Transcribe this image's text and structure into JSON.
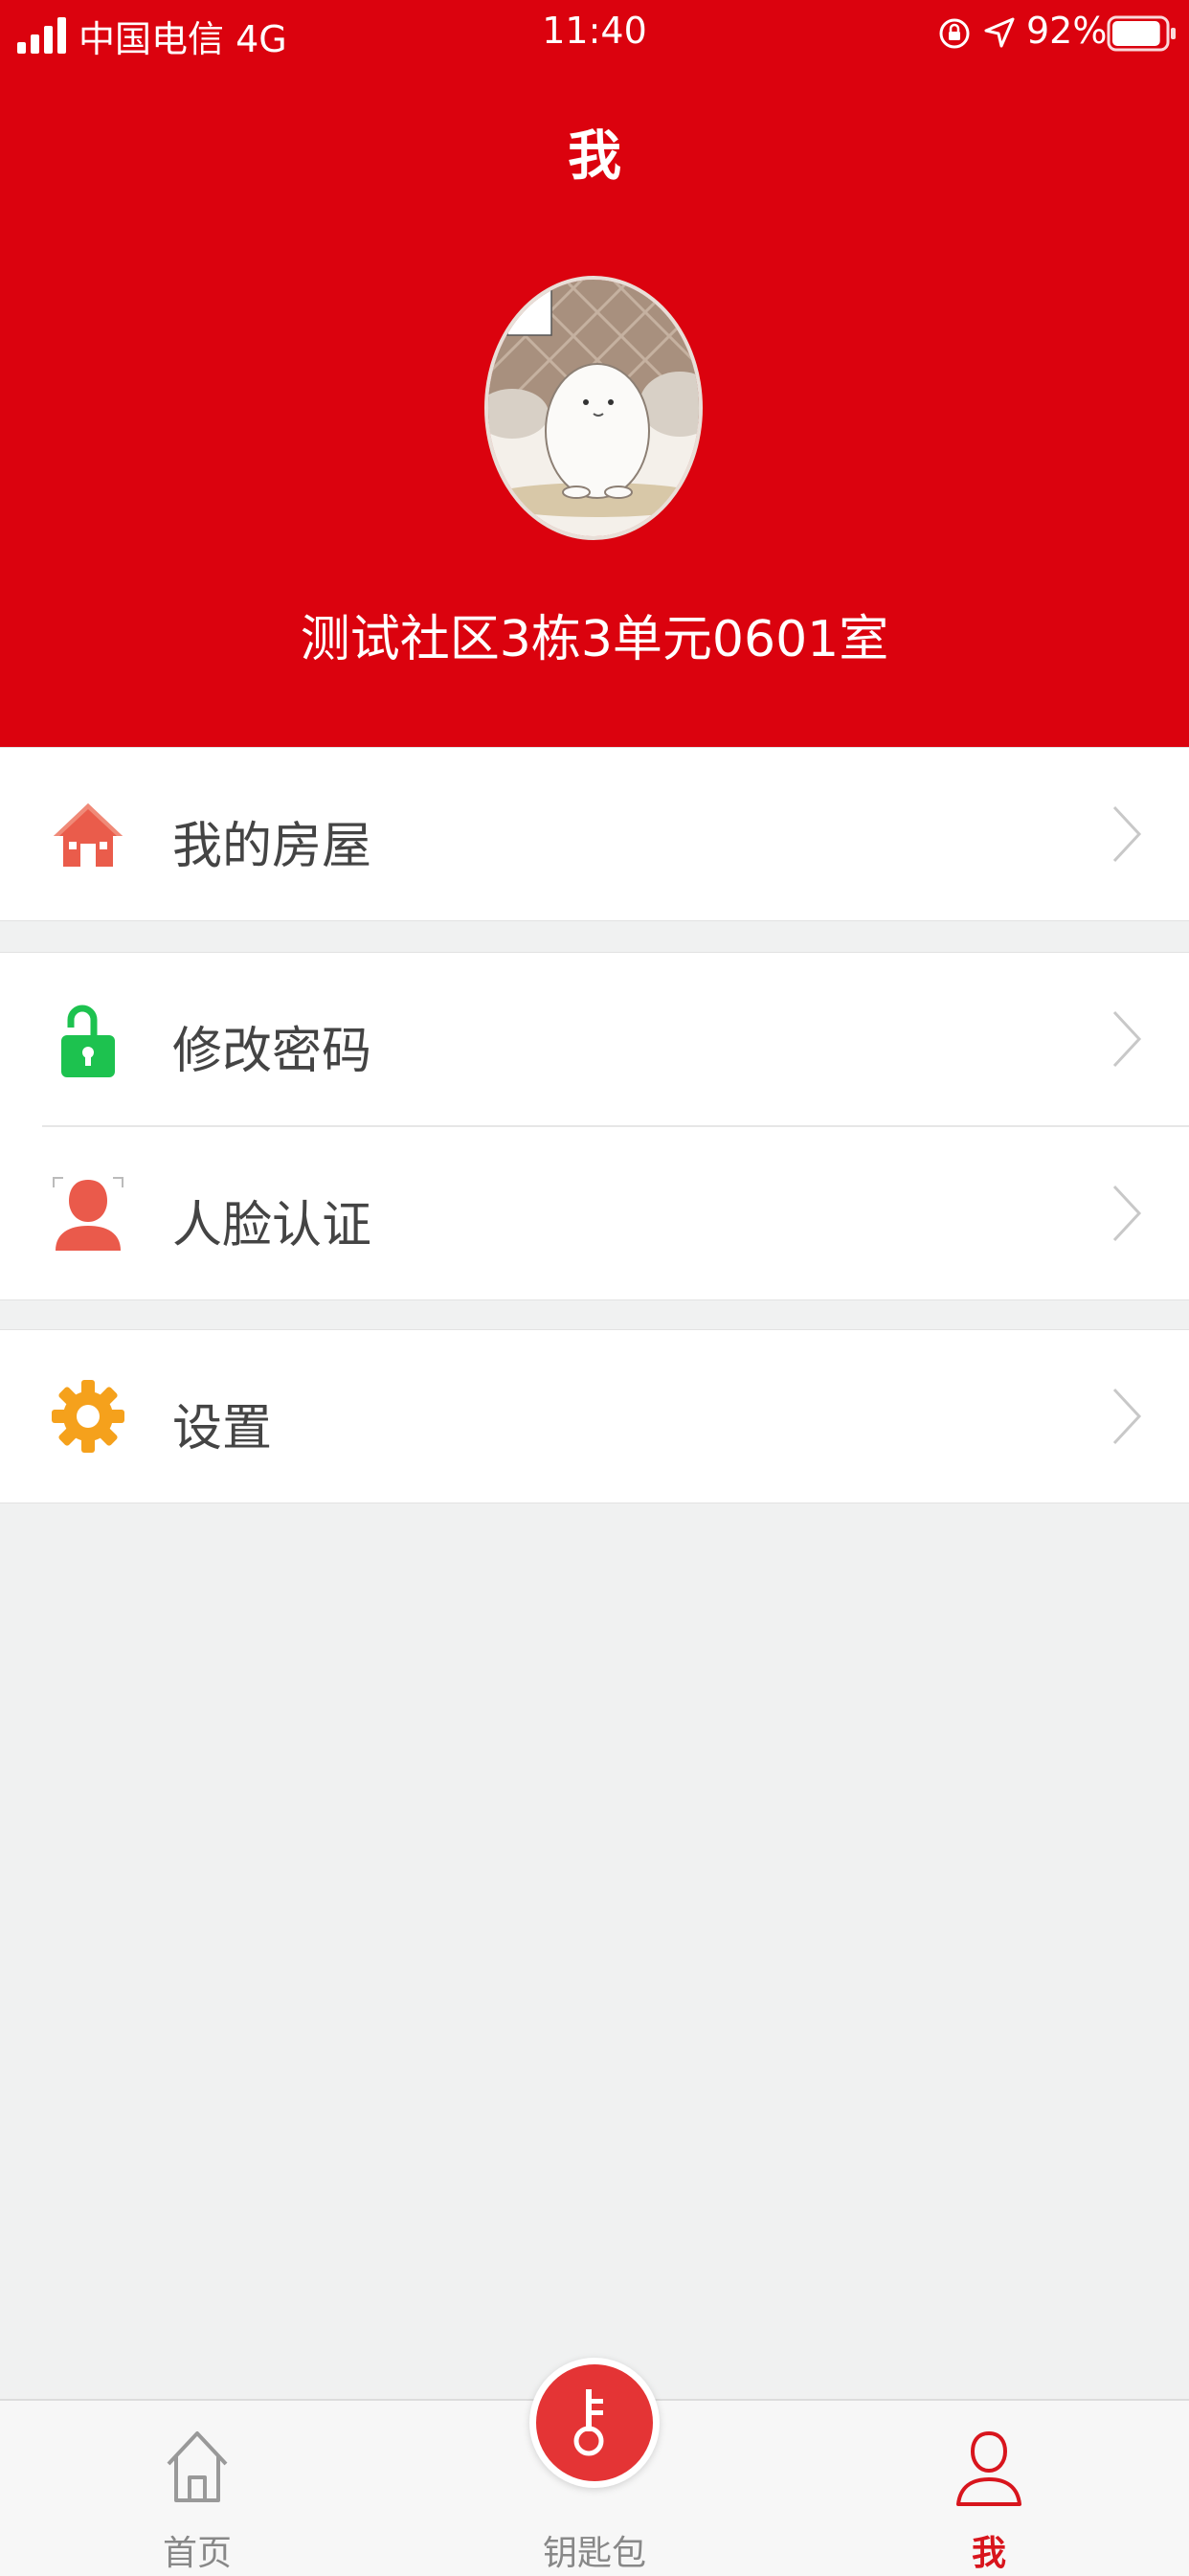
{
  "status": {
    "carrier": "中国电信 4G",
    "time": "11:40",
    "battery": "92%",
    "battery_level": 0.92
  },
  "header": {
    "title": "我",
    "address": "测试社区3栋3单元0601室"
  },
  "menu": {
    "my_house": "我的房屋",
    "change_password": "修改密码",
    "face_auth": "人脸认证",
    "settings": "设置"
  },
  "tabs": {
    "home": "首页",
    "keys": "钥匙包",
    "me": "我"
  },
  "colors": {
    "brand_red": "#db020e",
    "active_tab": "#d8151d",
    "house_icon": "#ea5c4b",
    "lock_icon": "#1dc24f",
    "face_icon": "#ea5a4b",
    "gear_icon": "#f5a11c"
  }
}
